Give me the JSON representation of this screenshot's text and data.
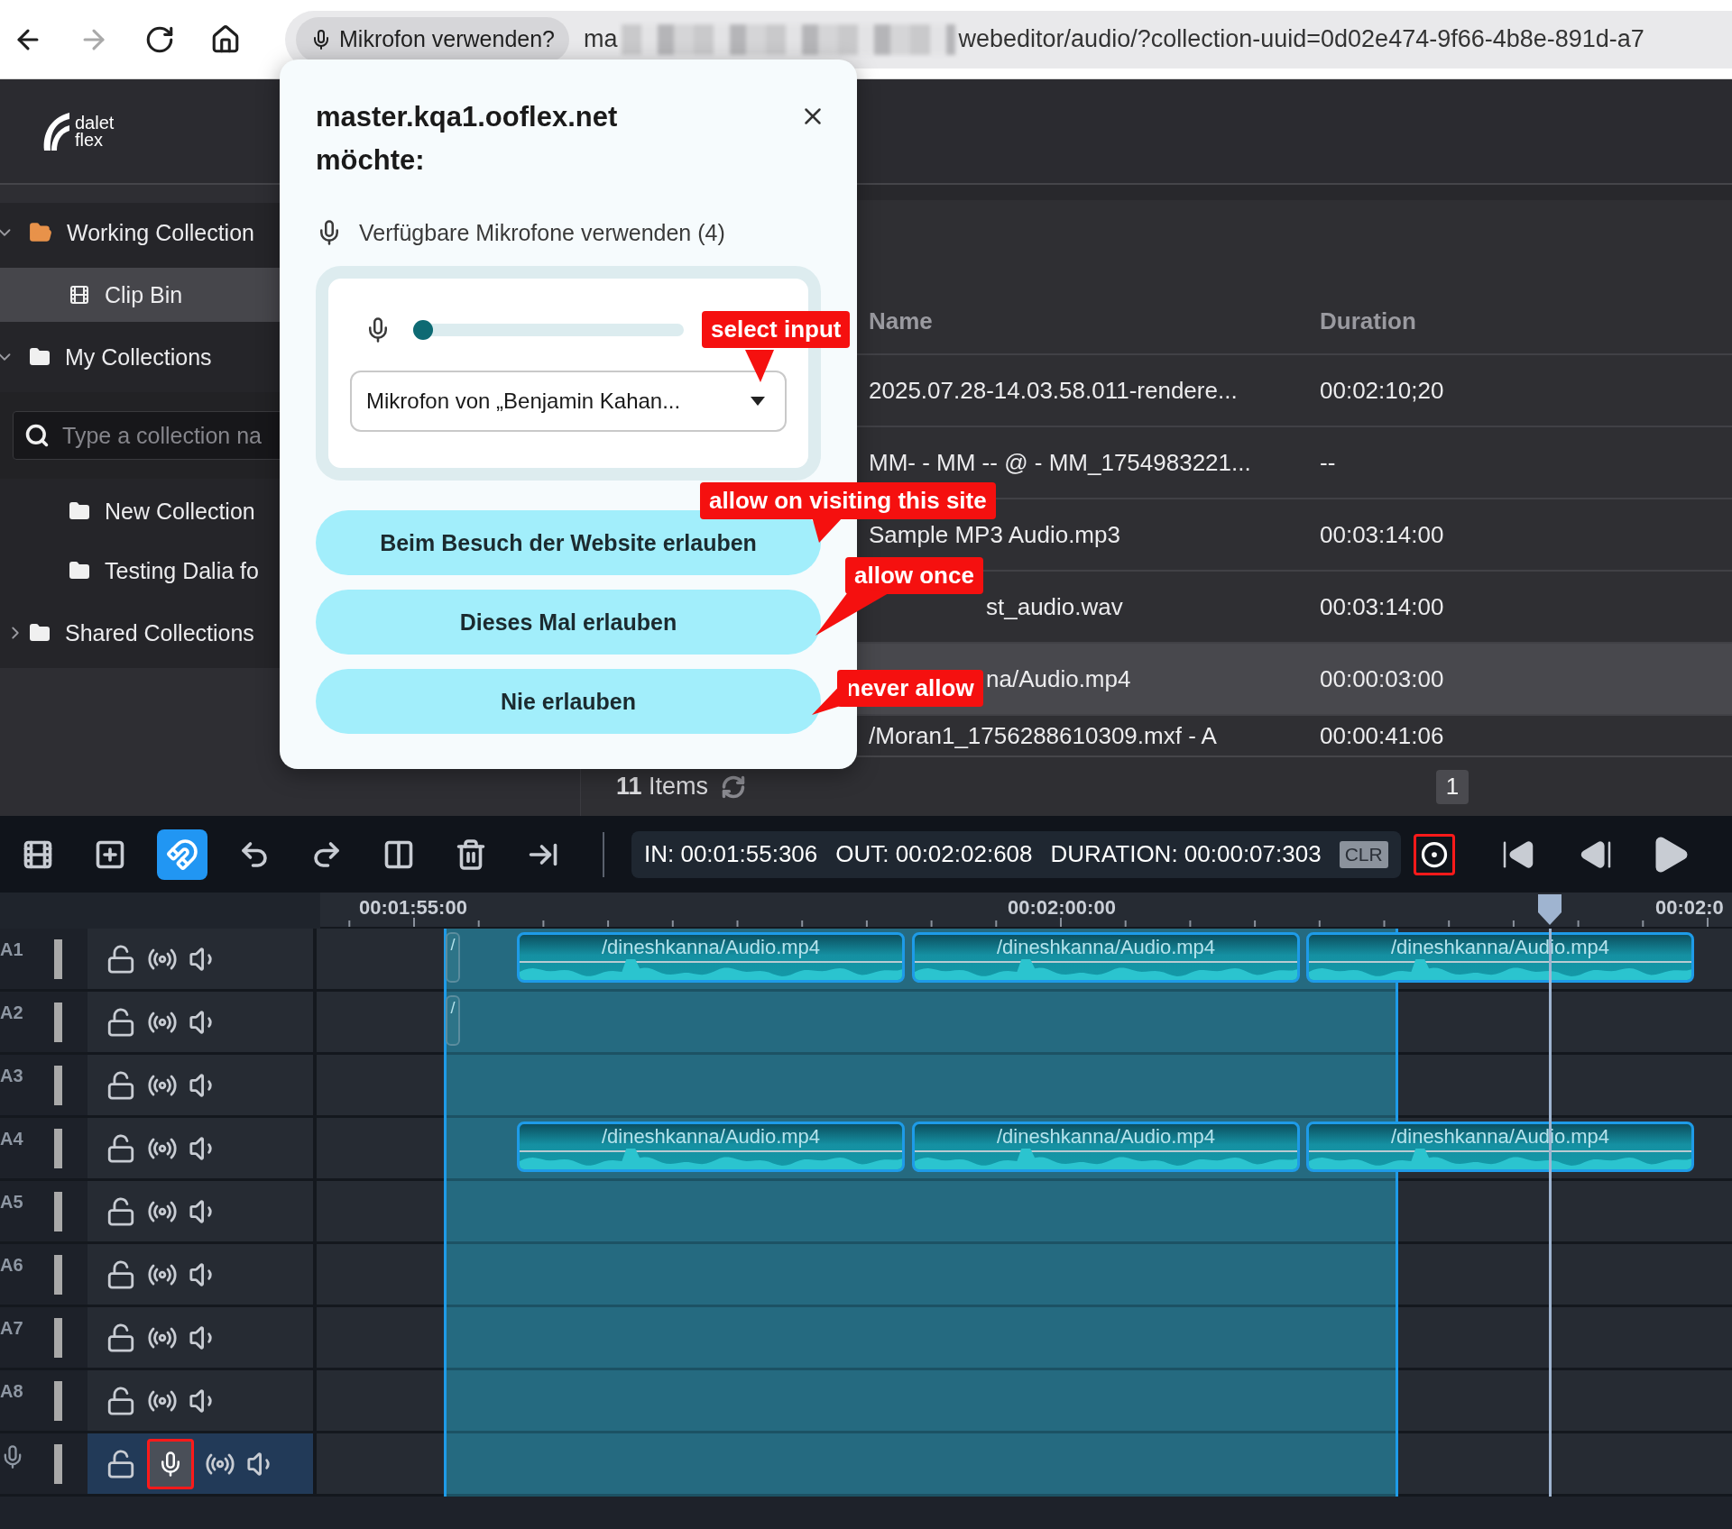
{
  "browser": {
    "nav": [
      {
        "kind": "back",
        "disabled": false
      },
      {
        "kind": "forward",
        "disabled": true
      },
      {
        "kind": "reload",
        "disabled": false
      },
      {
        "kind": "home",
        "disabled": false
      }
    ],
    "permission_chip": "Mikrofon verwenden?",
    "url_start": "ma",
    "url_end": "webeditor/audio/?collection-uuid=0d02e474-9f66-4b8e-891d-a7"
  },
  "logo": {
    "line1": "dalet",
    "line2": "flex"
  },
  "sidebar": {
    "items": [
      {
        "kind": "working",
        "label": "Working Collection",
        "expanded": true,
        "selected": false,
        "children": [
          {
            "kind": "bin",
            "label": "Clip Bin",
            "selected": true
          }
        ]
      },
      {
        "kind": "folder",
        "label": "My Collections",
        "expanded": true,
        "selected": false,
        "search": {
          "placeholder": "Type a collection na"
        },
        "children": [
          {
            "kind": "folder",
            "label": "New Collection",
            "selected": false
          },
          {
            "kind": "folder",
            "label": "Testing Dalia fo",
            "selected": false
          }
        ]
      },
      {
        "kind": "folder",
        "label": "Shared Collections",
        "expanded": false,
        "selected": false
      }
    ]
  },
  "table": {
    "columns": [
      "Name",
      "Duration"
    ],
    "rows": [
      {
        "name": "2025.07.28-14.03.58.011-rendere...",
        "duration": "00:02:10;20",
        "selected": false,
        "obscured": false
      },
      {
        "name": "MM- - MM -- @ - MM_1754983221...",
        "duration": "--",
        "selected": false,
        "obscured": false
      },
      {
        "name": "Sample MP3 Audio.mp3",
        "duration": "00:03:14:00",
        "selected": false,
        "obscured": false
      },
      {
        "name": "st_audio.wav",
        "duration": "00:03:14:00",
        "selected": false,
        "obscured": true
      },
      {
        "name": "na/Audio.mp4",
        "duration": "00:00:03:00",
        "selected": true,
        "obscured": true
      },
      {
        "name": "/Moran1_1756288610309.mxf - A",
        "duration": "00:00:41:06",
        "selected": false,
        "obscured": false
      }
    ]
  },
  "footer": {
    "count": "**11** Items",
    "page": "1"
  },
  "popup": {
    "site": "master.kqa1.ooflex.net",
    "wants": "möchte:",
    "permission": "Verfügbare Mikrofone verwenden (4)",
    "level": 0,
    "device": "Mikrofon von „Benjamin Kahan...",
    "buttons": [
      "Beim Besuch der Website erlauben",
      "Dieses Mal erlauben",
      "Nie erlauben"
    ]
  },
  "callouts": [
    {
      "text": "select input"
    },
    {
      "text": "allow on visiting this site"
    },
    {
      "text": "allow once"
    },
    {
      "text": "never allow"
    }
  ],
  "toolbar": {
    "tools": [
      {
        "kind": "add-clip",
        "active": false
      },
      {
        "kind": "add-marker",
        "active": false
      },
      {
        "kind": "snap",
        "active": true
      },
      {
        "kind": "undo",
        "active": false
      },
      {
        "kind": "redo",
        "active": false
      },
      {
        "kind": "split",
        "active": false
      },
      {
        "kind": "delete",
        "active": false
      },
      {
        "kind": "ripple",
        "active": false
      }
    ],
    "in": "IN: 00:01:55:306",
    "out": "OUT: 00:02:02:608",
    "duration": "DURATION: 00:00:07:303",
    "clear": "CLR",
    "record_highlighted": true,
    "transport": [
      {
        "kind": "to-start"
      },
      {
        "kind": "step-back"
      },
      {
        "kind": "play"
      }
    ]
  },
  "ruler": [
    "00:01:55:00",
    "00:02:00:00",
    "00:02:0"
  ],
  "tracks": [
    {
      "kind": "audio",
      "label": "A1",
      "clips": [
        {
          "kind": "stub",
          "label": "/"
        },
        {
          "kind": "full",
          "label": "/dineshkanna/Audio.mp4"
        },
        {
          "kind": "full",
          "label": "/dineshkanna/Audio.mp4"
        },
        {
          "kind": "full",
          "label": "/dineshkanna/Audio.mp4"
        }
      ]
    },
    {
      "kind": "audio",
      "label": "A2",
      "clips": [
        {
          "kind": "stub",
          "label": "/"
        }
      ]
    },
    {
      "kind": "audio",
      "label": "A3"
    },
    {
      "kind": "audio",
      "label": "A4",
      "clips": [
        {
          "kind": "full",
          "label": "/dineshkanna/Audio.mp4"
        },
        {
          "kind": "full",
          "label": "/dineshkanna/Audio.mp4"
        },
        {
          "kind": "full",
          "label": "/dineshkanna/Audio.mp4"
        }
      ]
    },
    {
      "kind": "audio",
      "label": "A5"
    },
    {
      "kind": "audio",
      "label": "A6"
    },
    {
      "kind": "audio",
      "label": "A7"
    },
    {
      "kind": "audio",
      "label": "A8"
    },
    {
      "kind": "record",
      "mic_highlighted": true
    }
  ]
}
